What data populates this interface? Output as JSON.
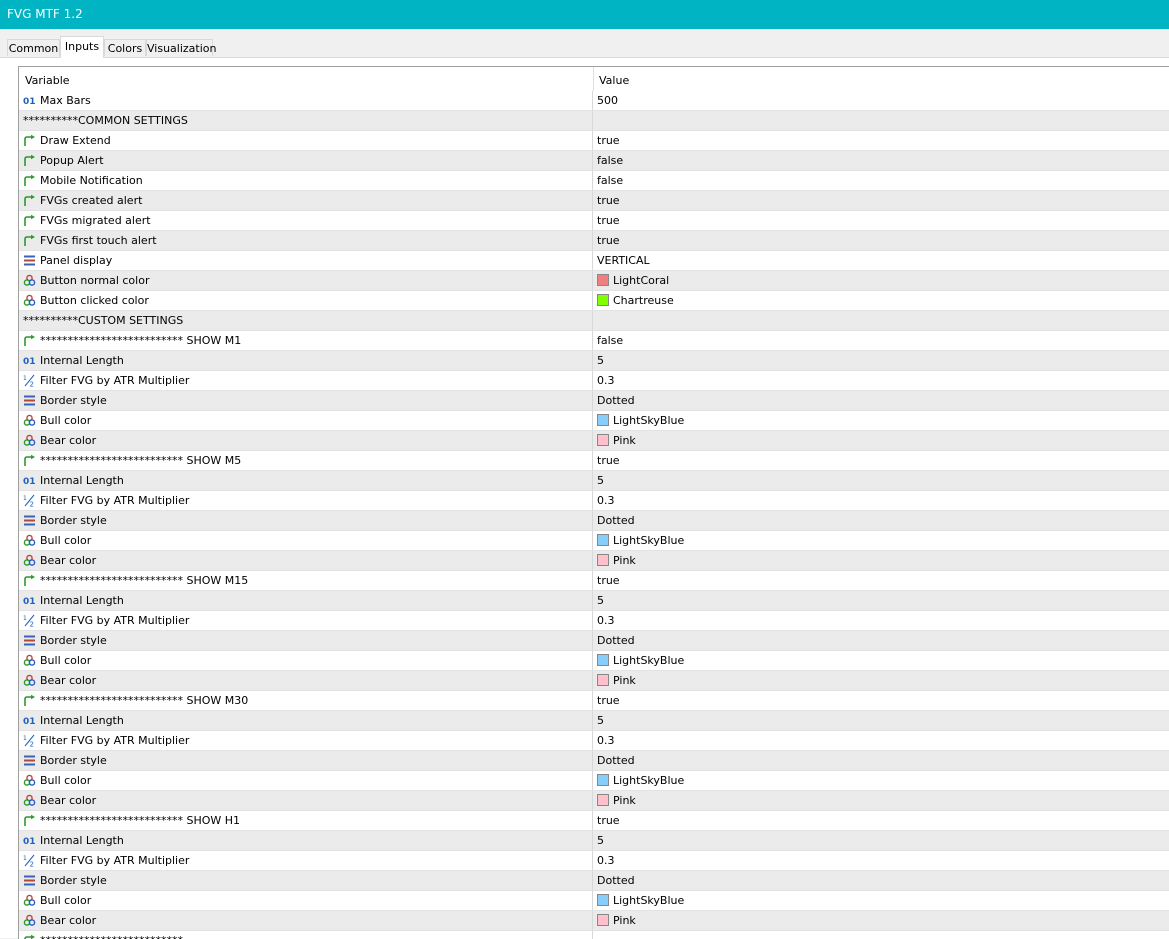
{
  "window": {
    "title": "FVG MTF 1.2"
  },
  "tabs": [
    {
      "label": "Common"
    },
    {
      "label": "Inputs",
      "active": true
    },
    {
      "label": "Colors"
    },
    {
      "label": "Visualization"
    }
  ],
  "table": {
    "header": {
      "variable": "Variable",
      "value": "Value"
    },
    "rows": [
      {
        "type": "int",
        "variable": "Max Bars",
        "value": "500"
      },
      {
        "type": "section",
        "variable": "**********COMMON SETTINGS",
        "value": ""
      },
      {
        "type": "bool",
        "variable": "Draw Extend",
        "value": "true"
      },
      {
        "type": "bool",
        "variable": "Popup Alert",
        "value": "false"
      },
      {
        "type": "bool",
        "variable": "Mobile Notification",
        "value": "false"
      },
      {
        "type": "bool",
        "variable": "FVGs created alert",
        "value": "true"
      },
      {
        "type": "bool",
        "variable": "FVGs migrated alert",
        "value": "true"
      },
      {
        "type": "bool",
        "variable": "FVGs first touch alert",
        "value": "true"
      },
      {
        "type": "enum",
        "variable": "Panel display",
        "value": "VERTICAL"
      },
      {
        "type": "color",
        "variable": "Button normal color",
        "value": "LightCoral",
        "swatch": "#f08080"
      },
      {
        "type": "color",
        "variable": "Button clicked color",
        "value": "Chartreuse",
        "swatch": "#7fff00"
      },
      {
        "type": "section",
        "variable": "**********CUSTOM SETTINGS",
        "value": ""
      },
      {
        "type": "bool",
        "variable": "************************** SHOW M1",
        "value": "false"
      },
      {
        "type": "int",
        "variable": "Internal Length",
        "value": "5"
      },
      {
        "type": "double",
        "variable": "Filter FVG by ATR Multiplier",
        "value": "0.3"
      },
      {
        "type": "enum",
        "variable": "Border style",
        "value": "Dotted"
      },
      {
        "type": "color",
        "variable": "Bull color",
        "value": "LightSkyBlue",
        "swatch": "#87cefa"
      },
      {
        "type": "color",
        "variable": "Bear color",
        "value": "Pink",
        "swatch": "#ffc0cb"
      },
      {
        "type": "bool",
        "variable": "************************** SHOW M5",
        "value": "true"
      },
      {
        "type": "int",
        "variable": "Internal Length",
        "value": "5"
      },
      {
        "type": "double",
        "variable": "Filter FVG by ATR Multiplier",
        "value": "0.3"
      },
      {
        "type": "enum",
        "variable": "Border style",
        "value": "Dotted"
      },
      {
        "type": "color",
        "variable": "Bull color",
        "value": "LightSkyBlue",
        "swatch": "#87cefa"
      },
      {
        "type": "color",
        "variable": "Bear color",
        "value": "Pink",
        "swatch": "#ffc0cb"
      },
      {
        "type": "bool",
        "variable": "************************** SHOW M15",
        "value": "true"
      },
      {
        "type": "int",
        "variable": "Internal Length",
        "value": "5"
      },
      {
        "type": "double",
        "variable": "Filter FVG by ATR Multiplier",
        "value": "0.3"
      },
      {
        "type": "enum",
        "variable": "Border style",
        "value": "Dotted"
      },
      {
        "type": "color",
        "variable": "Bull color",
        "value": "LightSkyBlue",
        "swatch": "#87cefa"
      },
      {
        "type": "color",
        "variable": "Bear color",
        "value": "Pink",
        "swatch": "#ffc0cb"
      },
      {
        "type": "bool",
        "variable": "************************** SHOW M30",
        "value": "true"
      },
      {
        "type": "int",
        "variable": "Internal Length",
        "value": "5"
      },
      {
        "type": "double",
        "variable": "Filter FVG by ATR Multiplier",
        "value": "0.3"
      },
      {
        "type": "enum",
        "variable": "Border style",
        "value": "Dotted"
      },
      {
        "type": "color",
        "variable": "Bull color",
        "value": "LightSkyBlue",
        "swatch": "#87cefa"
      },
      {
        "type": "color",
        "variable": "Bear color",
        "value": "Pink",
        "swatch": "#ffc0cb"
      },
      {
        "type": "bool",
        "variable": "************************** SHOW H1",
        "value": "true"
      },
      {
        "type": "int",
        "variable": "Internal Length",
        "value": "5"
      },
      {
        "type": "double",
        "variable": "Filter FVG by ATR Multiplier",
        "value": "0.3"
      },
      {
        "type": "enum",
        "variable": "Border style",
        "value": "Dotted"
      },
      {
        "type": "color",
        "variable": "Bull color",
        "value": "LightSkyBlue",
        "swatch": "#87cefa"
      },
      {
        "type": "color",
        "variable": "Bear color",
        "value": "Pink",
        "swatch": "#ffc0cb"
      },
      {
        "type": "bool",
        "variable": "**************************",
        "value": ""
      }
    ]
  }
}
